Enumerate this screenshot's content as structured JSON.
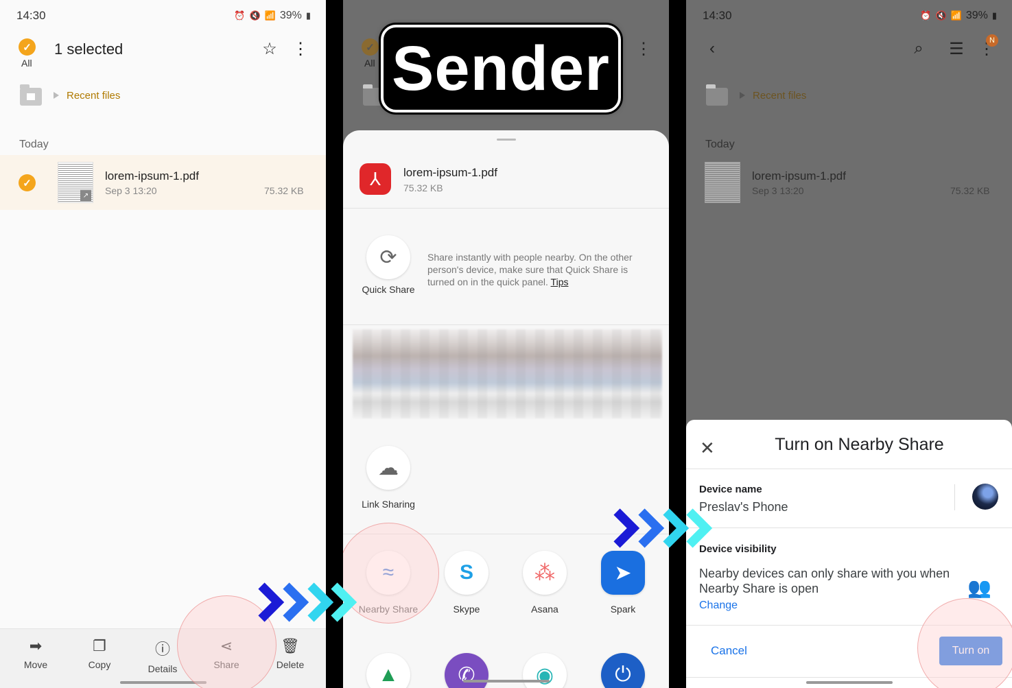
{
  "status": {
    "time": "14:30",
    "battery": "39%"
  },
  "panel1": {
    "select_all_label": "All",
    "selected_count": "1 selected",
    "breadcrumb": "Recent files",
    "section": "Today",
    "file": {
      "name": "lorem-ipsum-1.pdf",
      "date": "Sep 3 13:20",
      "size": "75.32 KB"
    },
    "bottom": [
      {
        "label": "Move",
        "icon": "move-icon"
      },
      {
        "label": "Copy",
        "icon": "copy-icon"
      },
      {
        "label": "Details",
        "icon": "info-icon"
      },
      {
        "label": "Share",
        "icon": "share-icon"
      },
      {
        "label": "Delete",
        "icon": "trash-icon"
      }
    ]
  },
  "panel2": {
    "overlay_title": "Sender",
    "select_all_label": "All",
    "file": {
      "name": "lorem-ipsum-1.pdf",
      "size": "75.32 KB"
    },
    "quick_share": {
      "label": "Quick Share",
      "desc": "Share instantly with people nearby. On the other person's device, make sure that Quick Share is turned on in the quick panel.",
      "tips": "Tips"
    },
    "link_sharing": "Link Sharing",
    "apps": [
      {
        "label": "Nearby Share",
        "icon": "nearby-share-icon"
      },
      {
        "label": "Skype",
        "icon": "skype-icon"
      },
      {
        "label": "Asana",
        "icon": "asana-icon"
      },
      {
        "label": "Spark",
        "icon": "spark-icon"
      }
    ]
  },
  "panel3": {
    "breadcrumb": "Recent files",
    "section": "Today",
    "badge": "N",
    "file": {
      "name": "lorem-ipsum-1.pdf",
      "date": "Sep 3 13:20",
      "size": "75.32 KB"
    },
    "dialog": {
      "title": "Turn on Nearby Share",
      "device_name_label": "Device name",
      "device_name": "Preslav's Phone",
      "visibility_label": "Device visibility",
      "visibility_text": "Nearby devices can only share with you when Nearby Share is open",
      "change": "Change",
      "cancel": "Cancel",
      "turn_on": "Turn on"
    }
  },
  "colors": {
    "accent": "#f4a51c",
    "link": "#1a73e8",
    "pdf": "#e0272a"
  }
}
